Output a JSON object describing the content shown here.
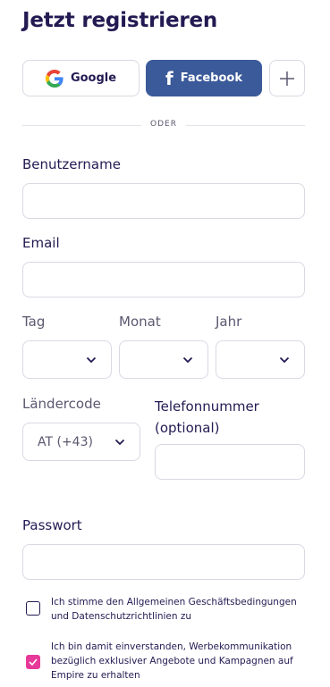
{
  "header": {
    "title": "Jetzt registrieren"
  },
  "social": {
    "google_label": "Google",
    "facebook_label": "Facebook",
    "colors": {
      "facebook": "#3b5a9a",
      "google_blue": "#4285F4",
      "google_red": "#EA4335",
      "google_yellow": "#FBBC05",
      "google_green": "#34A853"
    }
  },
  "divider": {
    "text": "ODER"
  },
  "form": {
    "username": {
      "label": "Benutzername",
      "value": "",
      "placeholder": ""
    },
    "email": {
      "label": "Email",
      "value": "",
      "placeholder": ""
    },
    "day": {
      "label": "Tag",
      "value": ""
    },
    "month": {
      "label": "Monat",
      "value": ""
    },
    "year": {
      "label": "Jahr",
      "value": ""
    },
    "country_code": {
      "label": "Ländercode",
      "value": "AT (+43)"
    },
    "phone": {
      "label_line1": "Telefonnummer",
      "label_line2": "(optional)",
      "value": ""
    },
    "password": {
      "label": "Passwort",
      "value": ""
    }
  },
  "consents": {
    "terms": {
      "text": "Ich stimme den Allgemeinen Geschäftsbedingungen und Datenschutzrichtlinien zu",
      "checked": false
    },
    "marketing": {
      "text": "Ich bin damit einverstanden, Werbekommunikation bezüglich exklusiver Angebote und Kampagnen auf Empire zu erhalten",
      "checked": true,
      "color": "#e7399a"
    }
  }
}
